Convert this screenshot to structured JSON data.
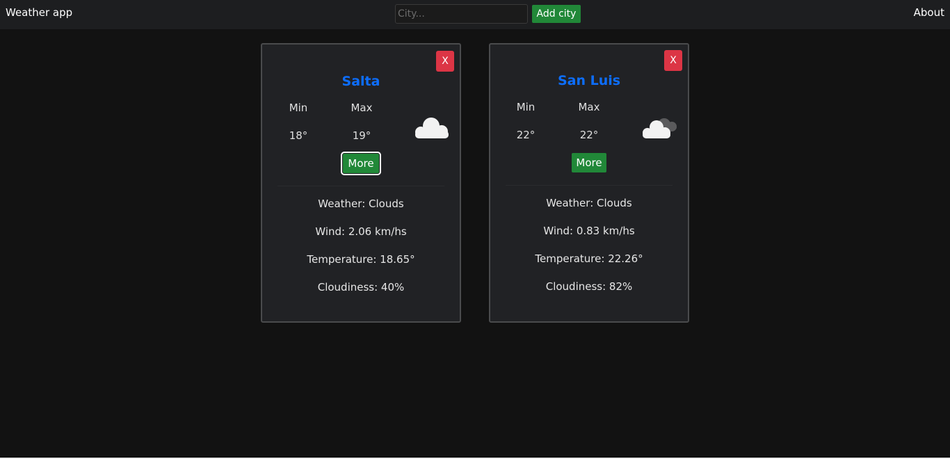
{
  "navbar": {
    "brand": "Weather app",
    "search_placeholder": "City...",
    "search_value": "",
    "add_button": "Add city",
    "about": "About"
  },
  "colors": {
    "background": "#121212",
    "navbar": "#1d1e20",
    "card": "#212225",
    "city_name": "#0d6efd",
    "green_button": "#218838",
    "red_button": "#dc3545"
  },
  "cards": [
    {
      "close_label": "X",
      "city": "Salta",
      "min_label": "Min",
      "max_label": "Max",
      "min": "18°",
      "max": "19°",
      "icon": "cloud-icon",
      "more_label": "More",
      "details": {
        "weather": "Weather: Clouds",
        "wind": "Wind: 2.06 km/hs",
        "temperature": "Temperature: 18.65°",
        "cloudiness": "Cloudiness: 40%"
      }
    },
    {
      "close_label": "X",
      "city": "San Luis",
      "min_label": "Min",
      "max_label": "Max",
      "min": "22°",
      "max": "22°",
      "icon": "broken-clouds-icon",
      "more_label": "More",
      "details": {
        "weather": "Weather: Clouds",
        "wind": "Wind: 0.83 km/hs",
        "temperature": "Temperature: 22.26°",
        "cloudiness": "Cloudiness: 82%"
      }
    }
  ]
}
